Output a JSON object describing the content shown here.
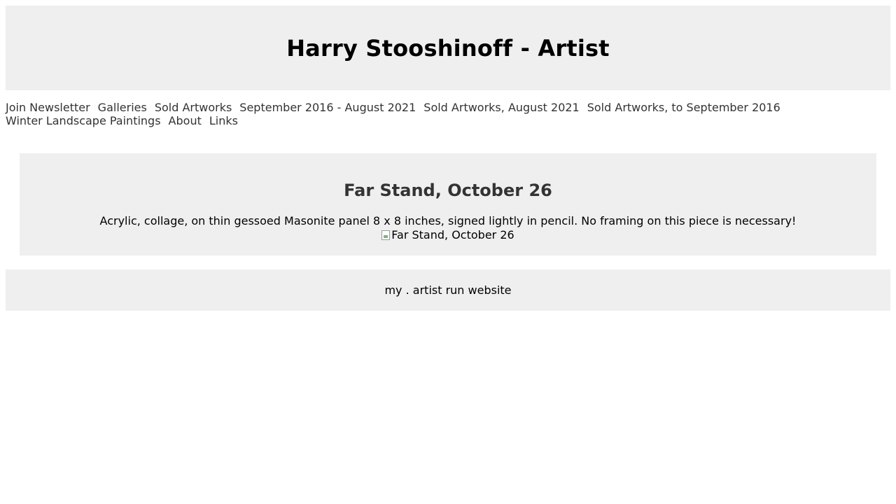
{
  "header": {
    "title": "Harry Stooshinoff - Artist"
  },
  "nav": {
    "row1": [
      "Join Newsletter",
      "Galleries",
      "Sold Artworks",
      "September 2016 - August 2021",
      "Sold Artworks, August 2021",
      "Sold Artworks, to September 2016"
    ],
    "row2": [
      "Winter Landscape Paintings",
      "About",
      "Links"
    ]
  },
  "artwork": {
    "title": "Far Stand, October 26",
    "description": "Acrylic, collage, on thin gessoed Masonite panel 8 x 8 inches, signed lightly in pencil. No framing on this piece is necessary!",
    "image_alt": "Far Stand, October 26"
  },
  "footer": {
    "text": "my . artist run website"
  },
  "colors": {
    "panel_background": "#efefef",
    "link_text": "#333333",
    "body_text": "#000000"
  }
}
